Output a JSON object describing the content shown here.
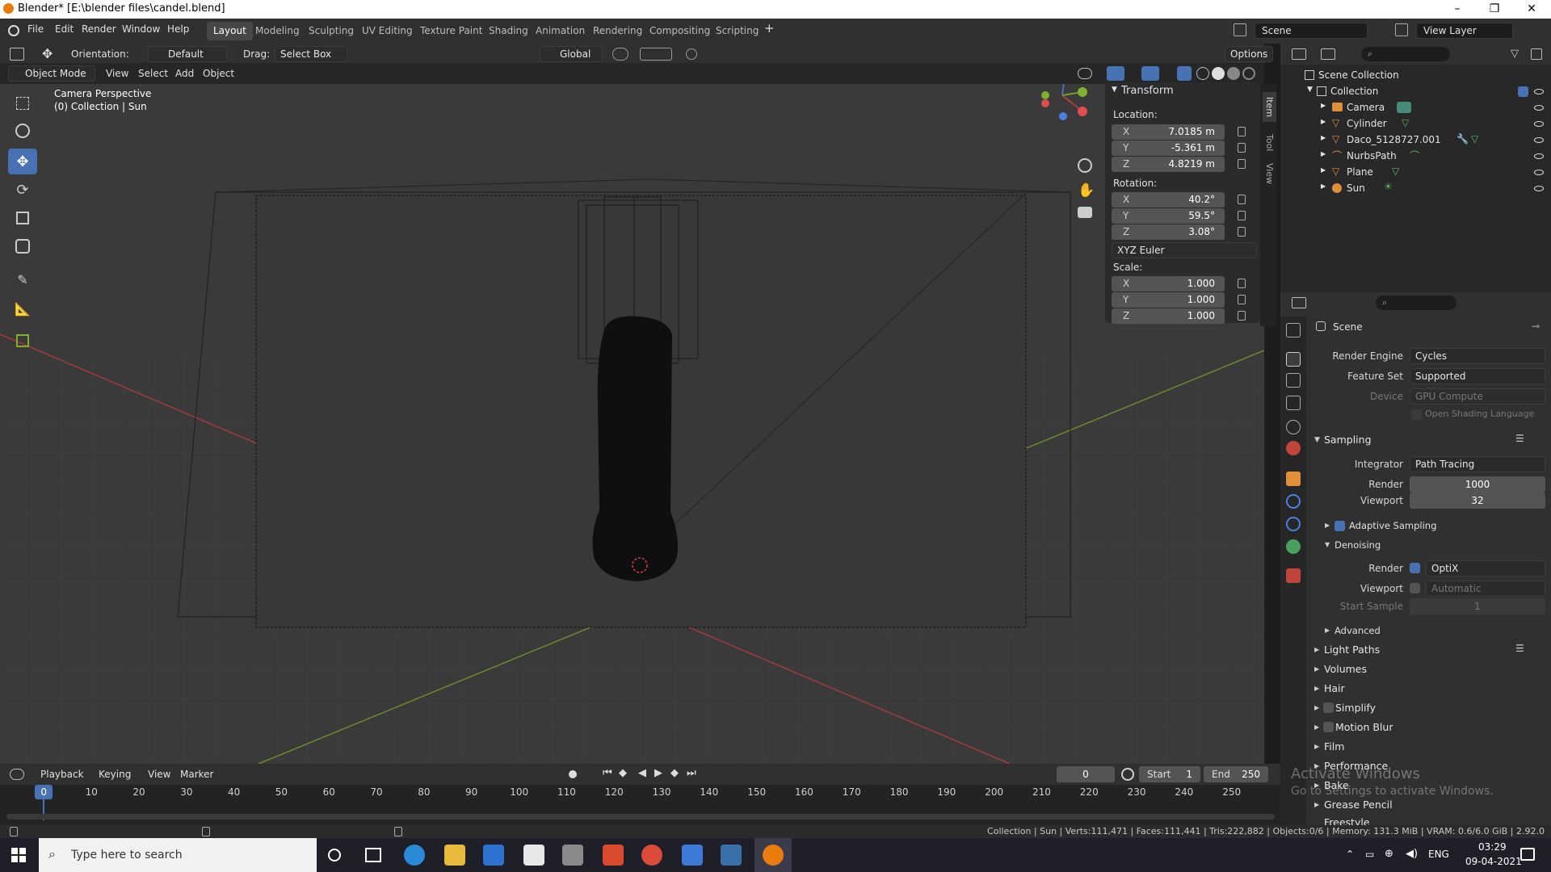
{
  "window": {
    "title": "Blender* [E:\\blender files\\candel.blend]"
  },
  "menu": [
    "File",
    "Edit",
    "Render",
    "Window",
    "Help"
  ],
  "workspaces": [
    "Layout",
    "Modeling",
    "Sculpting",
    "UV Editing",
    "Texture Paint",
    "Shading",
    "Animation",
    "Rendering",
    "Compositing",
    "Scripting"
  ],
  "active_workspace": "Layout",
  "scene_field": "Scene",
  "view_layer_field": "View Layer",
  "header": {
    "orientation_label": "Orientation:",
    "orientation_value": "Default",
    "drag_label": "Drag:",
    "drag_value": "Select Box",
    "transform_orient": "Global",
    "options": "Options"
  },
  "viewport_header": {
    "mode": "Object Mode",
    "menus": [
      "View",
      "Select",
      "Add",
      "Object"
    ]
  },
  "viewport": {
    "overlay_line1": "Camera Perspective",
    "overlay_line2": "(0) Collection | Sun"
  },
  "transform": {
    "title": "Transform",
    "location_label": "Location:",
    "location": [
      {
        "axis": "X",
        "value": "7.0185 m"
      },
      {
        "axis": "Y",
        "value": "-5.361 m"
      },
      {
        "axis": "Z",
        "value": "4.8219 m"
      }
    ],
    "rotation_label": "Rotation:",
    "rotation": [
      {
        "axis": "X",
        "value": "40.2°"
      },
      {
        "axis": "Y",
        "value": "59.5°"
      },
      {
        "axis": "Z",
        "value": "3.08°"
      }
    ],
    "rotation_mode": "XYZ Euler",
    "scale_label": "Scale:",
    "scale": [
      {
        "axis": "X",
        "value": "1.000"
      },
      {
        "axis": "Y",
        "value": "1.000"
      },
      {
        "axis": "Z",
        "value": "1.000"
      }
    ]
  },
  "sidetabs": [
    "Item",
    "Tool",
    "View"
  ],
  "outliner": {
    "root": "Scene Collection",
    "collection": "Collection",
    "items": [
      "Camera",
      "Cylinder",
      "Daco_5128727.001",
      "NurbsPath",
      "Plane",
      "Sun"
    ]
  },
  "properties": {
    "scene": "Scene",
    "render_engine_label": "Render Engine",
    "render_engine": "Cycles",
    "feature_set_label": "Feature Set",
    "feature_set": "Supported",
    "device_label": "Device",
    "device": "GPU Compute",
    "osl_label": "Open Shading Language",
    "sampling": "Sampling",
    "integrator_label": "Integrator",
    "integrator": "Path Tracing",
    "render_label": "Render",
    "render_samples": "1000",
    "viewport_label": "Viewport",
    "viewport_samples": "32",
    "adaptive": "Adaptive Sampling",
    "denoising": "Denoising",
    "denoise_render_label": "Render",
    "denoise_render": "OptiX",
    "denoise_viewport_label": "Viewport",
    "denoise_viewport": "Automatic",
    "start_sample_label": "Start Sample",
    "start_sample": "1",
    "advanced": "Advanced",
    "sections": [
      "Light Paths",
      "Volumes",
      "Hair",
      "Simplify",
      "Motion Blur",
      "Film",
      "Performance",
      "Bake",
      "Grease Pencil",
      "Freestyle"
    ]
  },
  "activate_windows": {
    "title": "Activate Windows",
    "subtitle": "Go to Settings to activate Windows."
  },
  "timeline": {
    "menus": [
      "Playback",
      "Keying",
      "View",
      "Marker"
    ],
    "current_frame": "0",
    "start_label": "Start",
    "start": "1",
    "end_label": "End",
    "end": "250",
    "ticks": [
      "0",
      "10",
      "20",
      "30",
      "40",
      "50",
      "60",
      "70",
      "80",
      "90",
      "100",
      "110",
      "120",
      "130",
      "140",
      "150",
      "160",
      "170",
      "180",
      "190",
      "200",
      "210",
      "220",
      "230",
      "240",
      "250"
    ]
  },
  "status": "Collection | Sun | Verts:111,471 | Faces:111,441 | Tris:222,882 | Objects:0/6 | Memory: 131.3 MiB | VRAM: 0.6/6.0 GiB | 2.92.0",
  "taskbar": {
    "search_placeholder": "Type here to search",
    "lang": "ENG",
    "time": "03:29",
    "date": "09-04-2021"
  }
}
